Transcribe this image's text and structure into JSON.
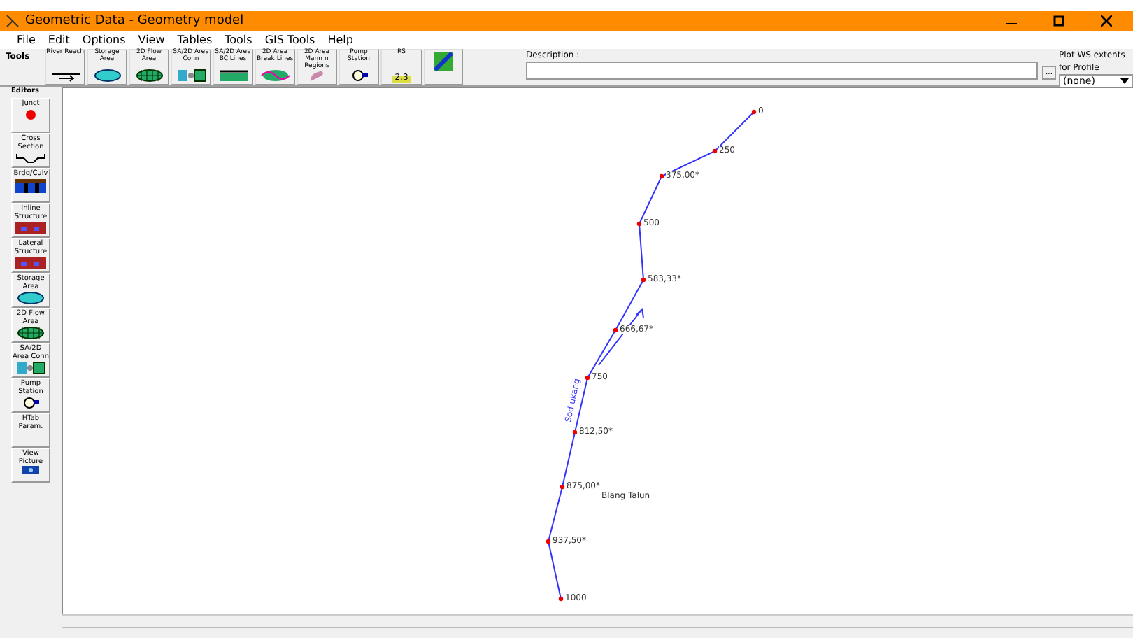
{
  "window": {
    "title": "Geometric Data - Geometry model"
  },
  "menu": [
    "File",
    "Edit",
    "Options",
    "View",
    "Tables",
    "Tools",
    "GIS Tools",
    "Help"
  ],
  "toolbar": {
    "tab_label": "Tools",
    "editors_label": "Editors",
    "tools": [
      {
        "label": "River Reach",
        "kind": "reach"
      },
      {
        "label": "Storage Area",
        "kind": "storage"
      },
      {
        "label": "2D Flow Area",
        "kind": "flow2d"
      },
      {
        "label": "SA/2D Area Conn",
        "kind": "conn"
      },
      {
        "label": "SA/2D Area BC Lines",
        "kind": "bc"
      },
      {
        "label": "2D Area Break Lines",
        "kind": "break"
      },
      {
        "label": "2D Area Mann n Regions",
        "kind": "mann"
      },
      {
        "label": "Pump Station",
        "kind": "pump"
      },
      {
        "label": "RS",
        "kind": "rs",
        "tag": "2.3"
      },
      {
        "kind": "map"
      }
    ]
  },
  "description": {
    "label": "Description :",
    "button": "..."
  },
  "profile": {
    "label": "Plot WS extents for Profile",
    "value": "(none)"
  },
  "editors": [
    {
      "label": "Junct",
      "kind": "junct"
    },
    {
      "label": "Cross Section",
      "kind": "xs"
    },
    {
      "label": "Brdg/Culv",
      "kind": "bridge"
    },
    {
      "label": "Inline Structure",
      "kind": "inline"
    },
    {
      "label": "Lateral Structure",
      "kind": "lateral"
    },
    {
      "label": "Storage Area",
      "kind": "storage"
    },
    {
      "label": "2D Flow Area",
      "kind": "flow2d"
    },
    {
      "label": "SA/2D Area Conn",
      "kind": "conn"
    },
    {
      "label": "Pump Station",
      "kind": "pump"
    },
    {
      "label": "HTab Param.",
      "kind": "none"
    },
    {
      "label": "View Picture",
      "kind": "picture"
    }
  ],
  "reach": {
    "river": "Sod ukang",
    "name": "Blang Talun",
    "stations": [
      "0",
      "250",
      "375,00*",
      "500",
      "583,33*",
      "666,67*",
      "750",
      "812,50*",
      "875,00*",
      "937,50*",
      "1000"
    ]
  }
}
